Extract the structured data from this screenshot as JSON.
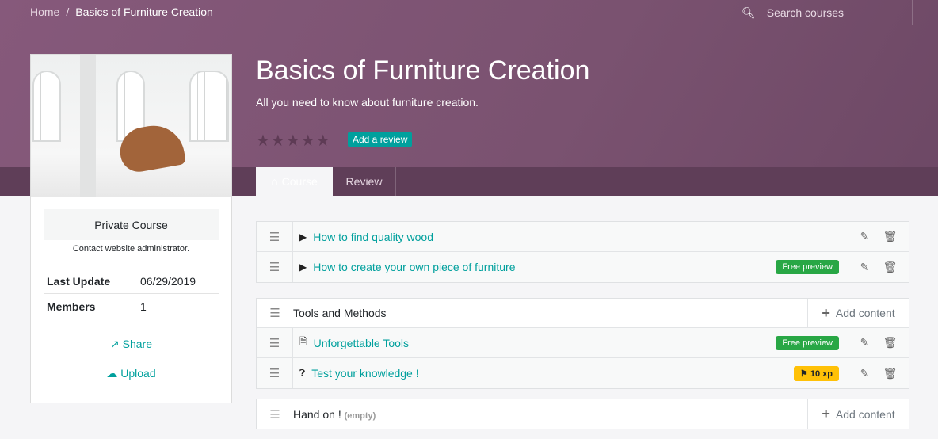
{
  "breadcrumb": {
    "home": "Home",
    "separator": "/",
    "current": "Basics of Furniture Creation"
  },
  "search": {
    "placeholder": "Search courses"
  },
  "course": {
    "title": "Basics of Furniture Creation",
    "subtitle": "All you need to know about furniture creation.",
    "rating": 0,
    "add_review": "Add a review"
  },
  "tabs": [
    {
      "label": "Course",
      "active": true
    },
    {
      "label": "Review"
    }
  ],
  "sidebar": {
    "status": "Private Course",
    "contact": "Contact website administrator.",
    "last_update_label": "Last Update",
    "last_update": "06/29/2019",
    "members_label": "Members",
    "members": "1",
    "share": "Share",
    "upload": "Upload"
  },
  "content": {
    "uncategorized": [
      {
        "title": "How to find quality wood",
        "type": "video"
      },
      {
        "title": "How to create your own piece of furniture",
        "type": "video",
        "badge": "Free preview"
      }
    ],
    "sections": [
      {
        "title": "Tools and Methods",
        "add": "Add content",
        "items": [
          {
            "title": "Unforgettable Tools",
            "type": "pdf",
            "badge": "Free preview"
          },
          {
            "title": "Test your knowledge !",
            "type": "quiz",
            "badge": "10 xp"
          }
        ]
      },
      {
        "title": "Hand on !",
        "empty": "(empty)",
        "add": "Add content"
      }
    ]
  },
  "colors": {
    "brand": "#875a7b",
    "accent": "#00a09d",
    "success": "#28a745",
    "warning": "#ffc107"
  }
}
